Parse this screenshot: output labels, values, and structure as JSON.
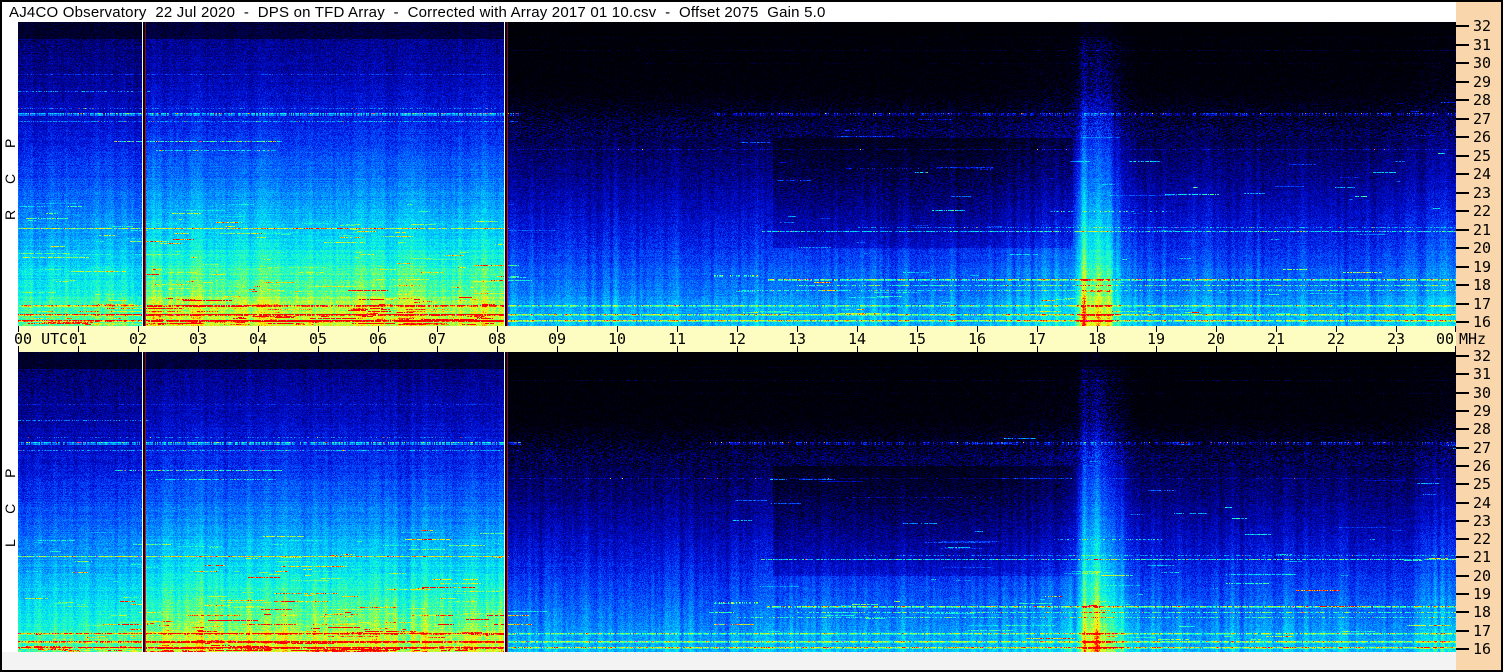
{
  "header": {
    "title": "AJ4CO Observatory  22 Jul 2020  -  DPS on TFD Array  -  Corrected with Array 2017 01 10.csv  -  Offset 2075  Gain 5.0",
    "observatory": "AJ4CO Observatory",
    "date": "22 Jul 2020",
    "instrument": "DPS on TFD Array",
    "correction": "Corrected with Array 2017 01 10.csv",
    "offset": "2075",
    "gain": "5.0"
  },
  "colors": {
    "titlebar_bg": "#ffffff",
    "time_axis_bg": "#fdfdc2",
    "freq_axis_bg": "#f9d6ac",
    "bottom_margin_bg": "#f3f3f4",
    "left_margin_bg": "#ffffff",
    "border": "#000000",
    "tick": "#000000"
  },
  "panels": [
    {
      "id": "RCP",
      "side_label": "R C P"
    },
    {
      "id": "LCP",
      "side_label": "L C P"
    }
  ],
  "time_axis": {
    "first_label": "00 UTC",
    "hour_labels": [
      "01",
      "02",
      "03",
      "04",
      "05",
      "06",
      "07",
      "08",
      "09",
      "10",
      "11",
      "12",
      "13",
      "14",
      "15",
      "16",
      "17",
      "18",
      "19",
      "20",
      "21",
      "22",
      "23"
    ],
    "last_label": "00"
  },
  "freq_axis": {
    "unit": "MHz",
    "ticks": [
      "32",
      "31",
      "30",
      "29",
      "28",
      "27",
      "26",
      "25",
      "24",
      "23",
      "22",
      "21",
      "20",
      "19",
      "18",
      "17",
      "16"
    ]
  },
  "chart_data": {
    "type": "heatmap",
    "title": "AJ4CO Observatory 22 Jul 2020 - DPS on TFD Array - Corrected with Array 2017 01 10.csv - Offset 2075 Gain 5.0",
    "x": {
      "label": "UTC",
      "range": [
        0,
        24
      ],
      "tick_step_hours": 1
    },
    "y": {
      "label": "MHz",
      "range": [
        16,
        32
      ],
      "tick_step_mhz": 1
    },
    "legend_position": "none",
    "grid": false,
    "series": [
      {
        "name": "RCP",
        "panel": "top",
        "polarization": "right circular"
      },
      {
        "name": "LCP",
        "panel": "bottom",
        "polarization": "left circular"
      }
    ],
    "colormap": [
      {
        "v": 0.0,
        "color": "#000004"
      },
      {
        "v": 0.08,
        "color": "#00001e"
      },
      {
        "v": 0.16,
        "color": "#000080"
      },
      {
        "v": 0.26,
        "color": "#0010d8"
      },
      {
        "v": 0.36,
        "color": "#0050ff"
      },
      {
        "v": 0.48,
        "color": "#00a8ff"
      },
      {
        "v": 0.58,
        "color": "#00e8f0"
      },
      {
        "v": 0.68,
        "color": "#30ffb0"
      },
      {
        "v": 0.76,
        "color": "#90ff50"
      },
      {
        "v": 0.84,
        "color": "#e8ff20"
      },
      {
        "v": 0.9,
        "color": "#ffd000"
      },
      {
        "v": 0.95,
        "color": "#ff6000"
      },
      {
        "v": 1.0,
        "color": "#ff0000"
      }
    ],
    "features": {
      "background": {
        "night": {
          "t0": 0,
          "t1": 8.13,
          "base": 0.17,
          "gain": 0.66,
          "exp": 1.55,
          "predawn_t": 2.08,
          "predawn_scale": 0.86
        },
        "day": {
          "base": 0.055,
          "gain": 0.46,
          "exp": 2.0,
          "highfreq_dark_above_mhz": 26.5,
          "highfreq_dark_amount": 0.07
        },
        "dark_patch": {
          "t0": 12.6,
          "t1": 17.6,
          "f0": 20,
          "f1": 26,
          "amount": 0.055
        },
        "top_edge_dark_above_mhz": 31.3
      },
      "vertical_markers": [
        {
          "t": 2.08
        },
        {
          "t": 8.13
        }
      ],
      "emission_bands": [
        {
          "t": 18.02,
          "sigma": 0.2,
          "amp": 0.38
        },
        {
          "t": 17.78,
          "sigma": 0.045,
          "amp": 0.22
        },
        {
          "t": 18.42,
          "sigma": 0.12,
          "amp": 0.1
        },
        {
          "t": 17.3,
          "sigma": 0.5,
          "amp": 0.07
        },
        {
          "t": 23.9,
          "sigma": 0.45,
          "amp": 0.08
        }
      ],
      "rfi_lines": [
        {
          "f": 27.3,
          "t0": 0.0,
          "t1": 8.4,
          "amp": 0.3,
          "th": 3,
          "duty": 0.8,
          "hot": 0.1
        },
        {
          "f": 27.55,
          "t0": 0.0,
          "t1": 8.0,
          "amp": 0.15,
          "th": 1,
          "duty": 0.4,
          "hot": 0.04
        },
        {
          "f": 27.3,
          "t0": 11.5,
          "t1": 24.0,
          "amp": 0.22,
          "th": 3,
          "duty": 0.55,
          "hot": 0.05
        },
        {
          "f": 26.85,
          "t0": 0.0,
          "t1": 8.4,
          "amp": 0.18,
          "th": 1,
          "duty": 0.7,
          "hot": 0.03
        },
        {
          "f": 28.5,
          "t0": 0.0,
          "t1": 2.2,
          "amp": 0.22,
          "th": 1,
          "duty": 0.5,
          "hot": 0.0
        },
        {
          "f": 25.8,
          "t0": 1.6,
          "t1": 4.4,
          "amp": 0.3,
          "th": 1,
          "duty": 0.8,
          "hot": 0.15
        },
        {
          "f": 25.3,
          "t0": 2.3,
          "t1": 4.3,
          "amp": 0.22,
          "th": 1,
          "duty": 0.7,
          "hot": 0.05
        },
        {
          "f": 25.35,
          "t0": 8.2,
          "t1": 24.0,
          "amp": 0.1,
          "th": 1,
          "duty": 0.5,
          "hot": 0.01
        },
        {
          "f": 21.1,
          "t0": 0.0,
          "t1": 8.2,
          "amp": 0.28,
          "th": 1,
          "duty": 0.95,
          "hot": 0.08
        },
        {
          "f": 20.9,
          "t0": 12.4,
          "t1": 24.0,
          "amp": 0.3,
          "th": 1,
          "duty": 0.8,
          "hot": 0.04
        },
        {
          "f": 21.15,
          "t0": 14.0,
          "t1": 24.0,
          "amp": 0.18,
          "th": 1,
          "duty": 0.6,
          "hot": 0.02
        },
        {
          "f": 18.35,
          "t0": 12.5,
          "t1": 24.0,
          "amp": 0.35,
          "th": 2,
          "duty": 0.85,
          "hot": 0.12
        },
        {
          "f": 18.0,
          "t0": 13.0,
          "t1": 24.0,
          "amp": 0.25,
          "th": 1,
          "duty": 0.7,
          "hot": 0.06
        },
        {
          "f": 17.75,
          "t0": 12.0,
          "t1": 24.0,
          "amp": 0.2,
          "th": 1,
          "duty": 0.6,
          "hot": 0.04
        },
        {
          "f": 18.55,
          "t0": 11.6,
          "t1": 12.35,
          "amp": 0.35,
          "th": 2,
          "duty": 0.5,
          "hot": 0.05
        },
        {
          "f": 16.9,
          "t0": 0.0,
          "t1": 24.0,
          "amp": 0.25,
          "th": 2,
          "duty": 0.9,
          "hot": 0.06
        },
        {
          "f": 16.45,
          "t0": 0.0,
          "t1": 24.0,
          "amp": 0.3,
          "th": 2,
          "duty": 0.95,
          "hot": 0.08
        },
        {
          "f": 16.1,
          "t0": 0.0,
          "t1": 24.0,
          "amp": 0.32,
          "th": 2,
          "duty": 0.95,
          "hot": 0.08
        },
        {
          "f": 31.4,
          "t0": 8.2,
          "t1": 24.0,
          "amp": 0.1,
          "th": 1,
          "duty": 0.8,
          "hot": 0.0
        },
        {
          "f": 30.7,
          "t0": 8.2,
          "t1": 24.0,
          "amp": 0.08,
          "th": 1,
          "duty": 0.7,
          "hot": 0.0
        },
        {
          "f": 30.0,
          "t0": 10.0,
          "t1": 24.0,
          "amp": 0.06,
          "th": 1,
          "duty": 0.6,
          "hot": 0.0
        },
        {
          "f": 29.4,
          "t0": 0.0,
          "t1": 8.2,
          "amp": 0.1,
          "th": 1,
          "duty": 0.6,
          "hot": 0.0
        },
        {
          "f": 22.0,
          "t0": 17.2,
          "t1": 19.3,
          "amp": 0.28,
          "th": 1,
          "duty": 0.35,
          "hot": 0.02
        },
        {
          "f": 24.3,
          "t0": 13.8,
          "t1": 16.3,
          "amp": 0.15,
          "th": 1,
          "duty": 0.3,
          "hot": 0.0
        }
      ],
      "night_streaks": {
        "count": 240,
        "t0": 0.0,
        "t1": 8.2,
        "fmin": 15.9,
        "fmax": 22.5,
        "low_bias": 2.2,
        "amp_min": 0.08,
        "amp_max": 0.5
      },
      "day_streaks": {
        "count": 90,
        "t0": 11.5,
        "t1": 24.0,
        "fmin": 16.5,
        "fmax": 28.0,
        "low_bias": 1.8,
        "amp_min": 0.1,
        "amp_max": 0.55
      },
      "noise": {
        "row": 0.045,
        "col": 0.035,
        "pixel": 0.055,
        "day_col_boost": 1.6
      }
    }
  }
}
